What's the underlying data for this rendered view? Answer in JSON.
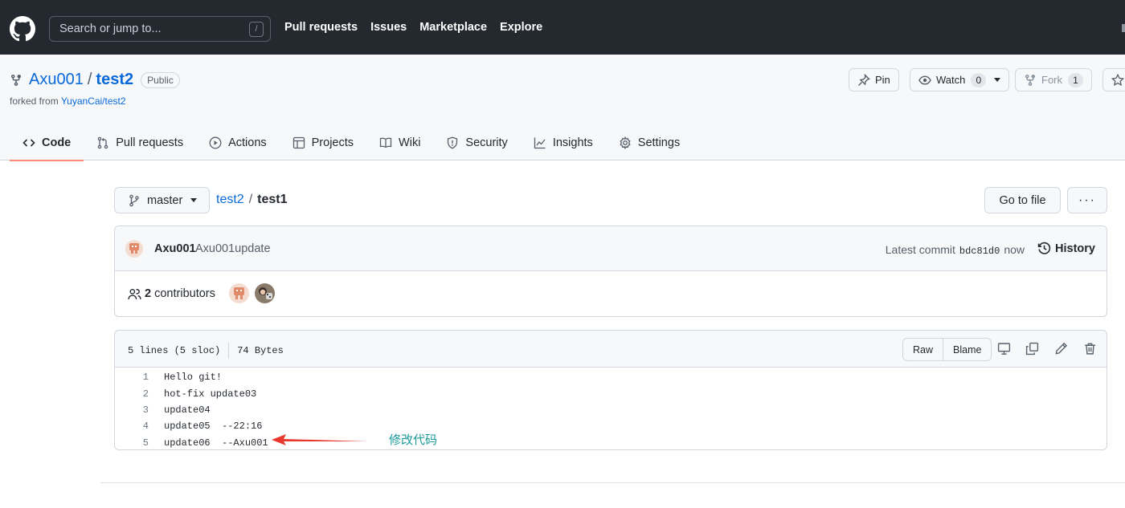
{
  "header": {
    "search_placeholder": "Search or jump to...",
    "search_shortcut": "/",
    "nav": [
      "Pull requests",
      "Issues",
      "Marketplace",
      "Explore"
    ]
  },
  "repo": {
    "owner": "Axu001",
    "separator": "/",
    "name": "test2",
    "visibility": "Public",
    "forked_prefix": "forked from ",
    "forked_source": "YuyanCai/test2",
    "actions": {
      "pin_label": "Pin",
      "watch_label": "Watch",
      "watch_count": "0",
      "fork_label": "Fork",
      "fork_count": "1"
    },
    "tabs": [
      "Code",
      "Pull requests",
      "Actions",
      "Projects",
      "Wiki",
      "Security",
      "Insights",
      "Settings"
    ]
  },
  "file_nav": {
    "branch": "master",
    "crumb_repo": "test2",
    "crumb_sep": "/",
    "crumb_file": "test1",
    "go_to_file": "Go to file",
    "more": "···"
  },
  "commit": {
    "author": "Axu001",
    "message": "Axu001update",
    "latest_label": "Latest commit",
    "sha": "bdc81d0",
    "when": "now",
    "history_label": "History",
    "contributors_count": "2",
    "contributors_label": "contributors"
  },
  "file": {
    "lines_info": "5 lines (5 sloc)",
    "size": "74 Bytes",
    "raw_label": "Raw",
    "blame_label": "Blame",
    "lines": [
      {
        "num": "1",
        "text": "Hello git!"
      },
      {
        "num": "2",
        "text": "hot-fix update03"
      },
      {
        "num": "3",
        "text": "update04"
      },
      {
        "num": "4",
        "text": "update05  --22:16"
      },
      {
        "num": "5",
        "text": "update06  --Axu001"
      }
    ]
  },
  "annotation": {
    "text": "修改代码",
    "color": "#1a9a98",
    "arrow_color": "#e8372c"
  },
  "colors": {
    "header_bg": "#24292f",
    "link": "#0969da",
    "tab_underline": "#fd8c73"
  }
}
